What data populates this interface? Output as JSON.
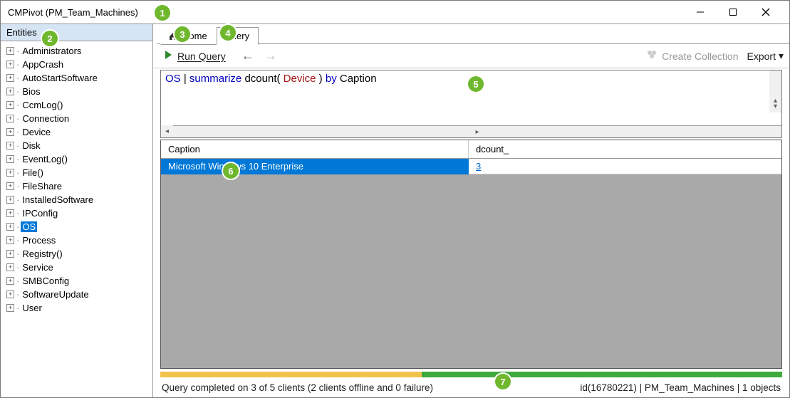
{
  "window": {
    "title": "CMPivot (PM_Team_Machines)"
  },
  "sidebar": {
    "header": "Entities",
    "items": [
      {
        "label": "Administrators",
        "selected": false
      },
      {
        "label": "AppCrash",
        "selected": false
      },
      {
        "label": "AutoStartSoftware",
        "selected": false
      },
      {
        "label": "Bios",
        "selected": false
      },
      {
        "label": "CcmLog()",
        "selected": false
      },
      {
        "label": "Connection",
        "selected": false
      },
      {
        "label": "Device",
        "selected": false
      },
      {
        "label": "Disk",
        "selected": false
      },
      {
        "label": "EventLog()",
        "selected": false
      },
      {
        "label": "File()",
        "selected": false
      },
      {
        "label": "FileShare",
        "selected": false
      },
      {
        "label": "InstalledSoftware",
        "selected": false
      },
      {
        "label": "IPConfig",
        "selected": false
      },
      {
        "label": "OS",
        "selected": true
      },
      {
        "label": "Process",
        "selected": false
      },
      {
        "label": "Registry()",
        "selected": false
      },
      {
        "label": "Service",
        "selected": false
      },
      {
        "label": "SMBConfig",
        "selected": false
      },
      {
        "label": "SoftwareUpdate",
        "selected": false
      },
      {
        "label": "User",
        "selected": false
      }
    ]
  },
  "tabs": {
    "home": "Home",
    "query": "Query",
    "active": "query"
  },
  "toolbar": {
    "run_label": "Run Query",
    "create_collection": "Create Collection",
    "export": "Export"
  },
  "query": {
    "entity": "OS",
    "pipe": " | ",
    "op": "summarize",
    "func": " dcount( ",
    "arg": "Device",
    "func2": " ) ",
    "by": "by",
    "field": " Caption"
  },
  "results": {
    "columns": [
      "Caption",
      "dcount_"
    ],
    "rows": [
      {
        "caption": "Microsoft Windows 10 Enterprise",
        "dcount": "3"
      }
    ]
  },
  "status": {
    "left": "Query completed on 3 of 5 clients (2 clients offline and 0 failure)",
    "right": "id(16780221)  |  PM_Team_Machines  |  1 objects"
  },
  "badges": [
    "1",
    "2",
    "3",
    "4",
    "5",
    "6",
    "7"
  ]
}
